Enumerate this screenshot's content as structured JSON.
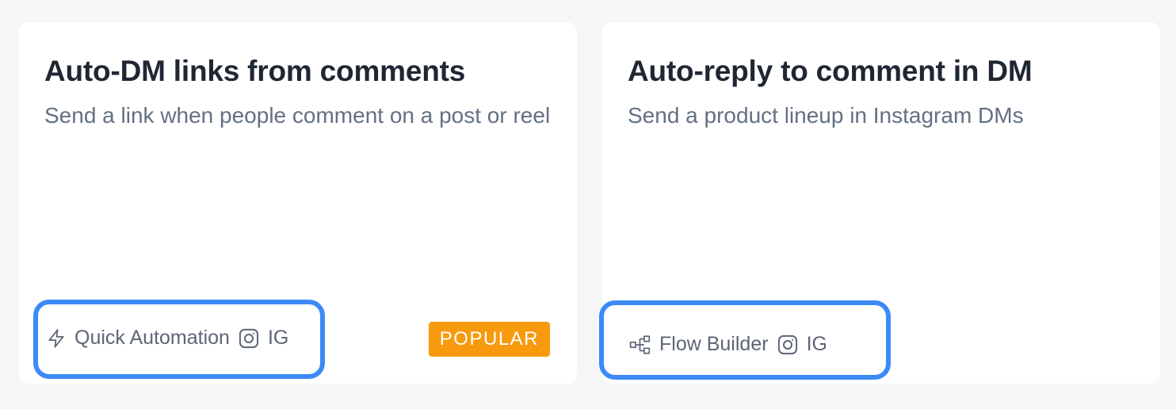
{
  "cards": [
    {
      "title": "Auto-DM links from comments",
      "description": "Send a link when people comment on a post or reel",
      "type_icon": "lightning-icon",
      "type_label": "Quick Automation",
      "platform_icon": "instagram-icon",
      "platform_label": "IG",
      "badge": "POPULAR"
    },
    {
      "title": "Auto-reply to comment in DM",
      "description": "Send a product lineup in Instagram DMs",
      "type_icon": "flow-builder-icon",
      "type_label": "Flow Builder",
      "platform_icon": "instagram-icon",
      "platform_label": "IG"
    }
  ],
  "colors": {
    "background": "#f5f6f8",
    "card": "#ffffff",
    "title": "#1f2733",
    "description": "#637083",
    "badge": "#f79a0d",
    "highlight": "#3d8af7"
  }
}
